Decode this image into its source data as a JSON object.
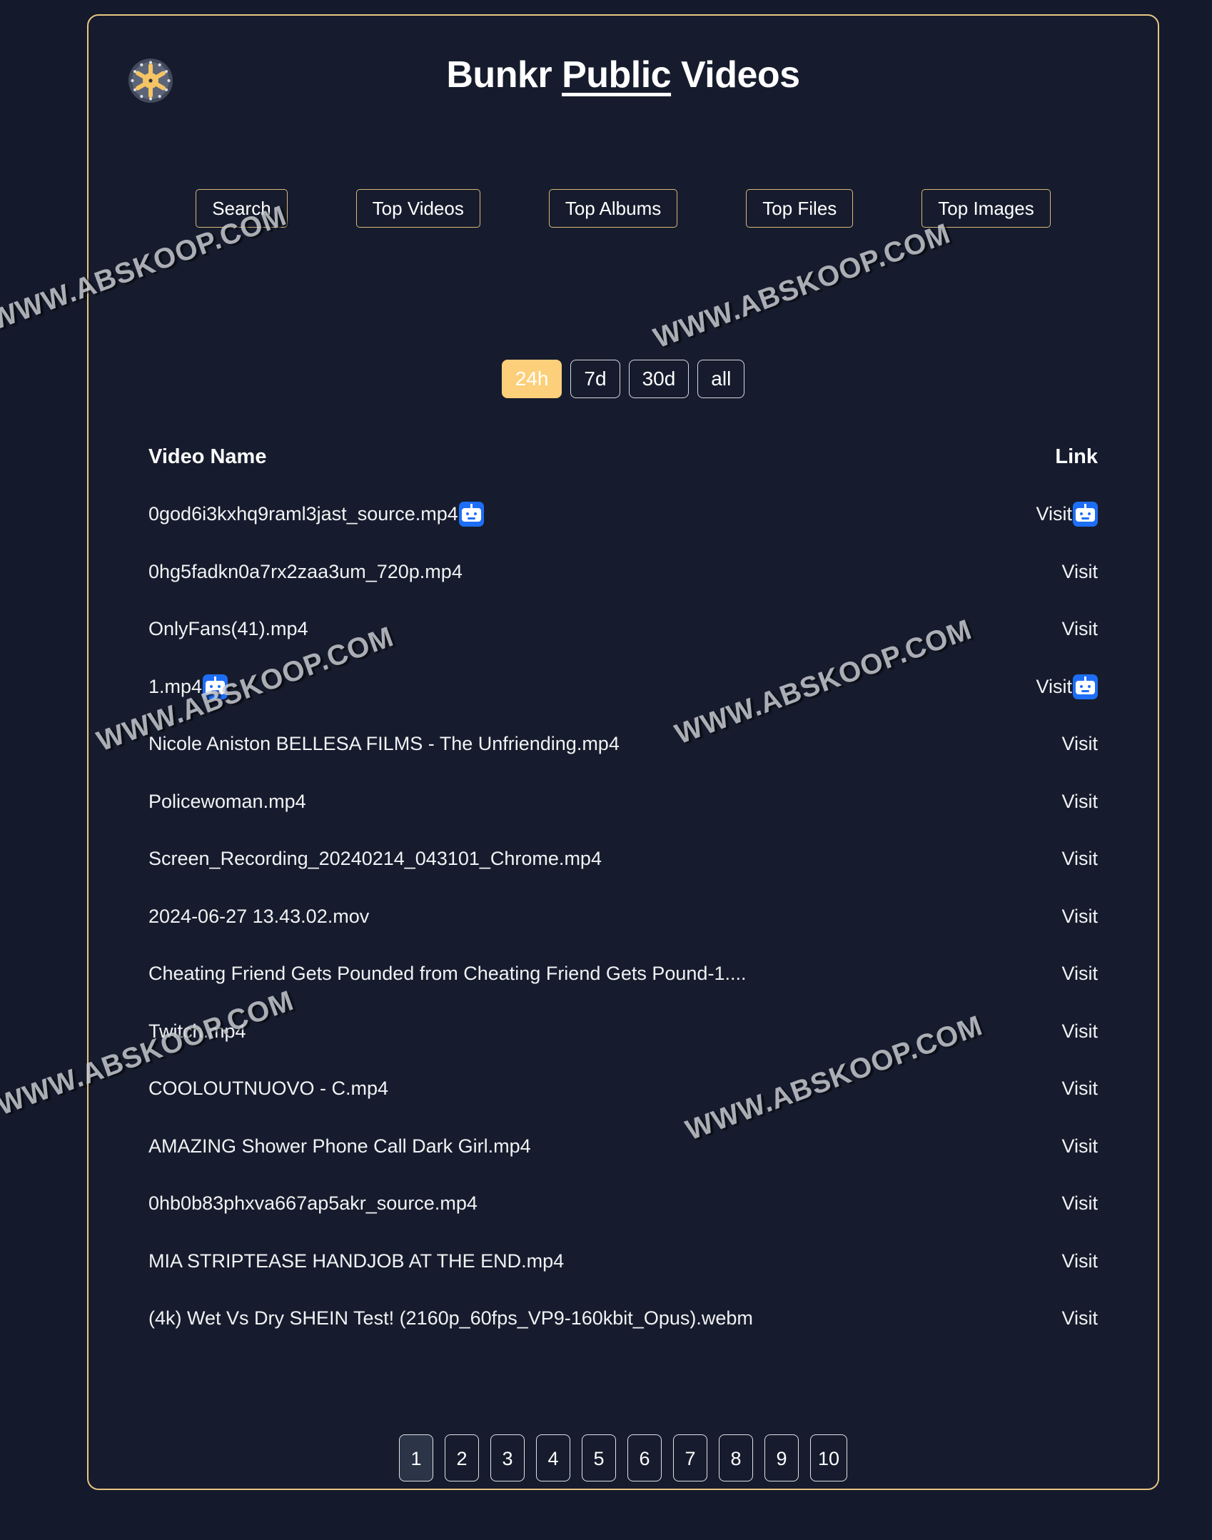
{
  "site": {
    "logo_icon": "vault-dial-icon",
    "title_prefix": "Bunkr ",
    "title_emphasis": "Public",
    "title_suffix": " Videos",
    "watermark": "WWW.ABSKOOP.COM",
    "accent_gold": "#e8c784",
    "accent_active": "#fccf7a",
    "background": "#141a2b",
    "robot_badge_color": "#1e6ef5"
  },
  "nav": {
    "items": [
      {
        "label": "Search"
      },
      {
        "label": "Top Videos"
      },
      {
        "label": "Top Albums"
      },
      {
        "label": "Top Files"
      },
      {
        "label": "Top Images"
      }
    ]
  },
  "time_filter": {
    "selected": "24h",
    "options": [
      {
        "label": "24h",
        "active": true
      },
      {
        "label": "7d",
        "active": false
      },
      {
        "label": "30d",
        "active": false
      },
      {
        "label": "all",
        "active": false
      }
    ]
  },
  "table": {
    "columns": [
      "Video Name",
      "Link"
    ],
    "link_label": "Visit",
    "rows": [
      {
        "name": "0god6i3kxhq9raml3jast_source.mp4",
        "link": "Visit",
        "name_badge": true,
        "link_badge": true
      },
      {
        "name": "0hg5fadkn0a7rx2zaa3um_720p.mp4",
        "link": "Visit",
        "name_badge": false,
        "link_badge": false
      },
      {
        "name": "OnlyFans(41).mp4",
        "link": "Visit",
        "name_badge": false,
        "link_badge": false
      },
      {
        "name": "1.mp4",
        "link": "Visit",
        "name_badge": true,
        "link_badge": true
      },
      {
        "name": "Nicole Aniston BELLESA FILMS - The Unfriending.mp4",
        "link": "Visit",
        "name_badge": false,
        "link_badge": false
      },
      {
        "name": "Policewoman.mp4",
        "link": "Visit",
        "name_badge": false,
        "link_badge": false
      },
      {
        "name": "Screen_Recording_20240214_043101_Chrome.mp4",
        "link": "Visit",
        "name_badge": false,
        "link_badge": false
      },
      {
        "name": "2024-06-27 13.43.02.mov",
        "link": "Visit",
        "name_badge": false,
        "link_badge": false
      },
      {
        "name": "Cheating Friend Gets Pounded from Cheating Friend Gets Pound-1....",
        "link": "Visit",
        "name_badge": false,
        "link_badge": false
      },
      {
        "name": "Twitch.mp4",
        "link": "Visit",
        "name_badge": false,
        "link_badge": false
      },
      {
        "name": "COOLOUTNUOVO - C.mp4",
        "link": "Visit",
        "name_badge": false,
        "link_badge": false
      },
      {
        "name": "AMAZING Shower Phone Call Dark Girl.mp4",
        "link": "Visit",
        "name_badge": false,
        "link_badge": false
      },
      {
        "name": "0hb0b83phxva667ap5akr_source.mp4",
        "link": "Visit",
        "name_badge": false,
        "link_badge": false
      },
      {
        "name": "MIA STRIPTEASE HANDJOB AT THE END.mp4",
        "link": "Visit",
        "name_badge": false,
        "link_badge": false
      },
      {
        "name": "(4k) Wet Vs Dry SHEIN Test! (2160p_60fps_VP9-160kbit_Opus).webm",
        "link": "Visit",
        "name_badge": false,
        "link_badge": false
      }
    ]
  },
  "pagination": {
    "current": "1",
    "pages": [
      "1",
      "2",
      "3",
      "4",
      "5",
      "6",
      "7",
      "8",
      "9",
      "10"
    ]
  }
}
